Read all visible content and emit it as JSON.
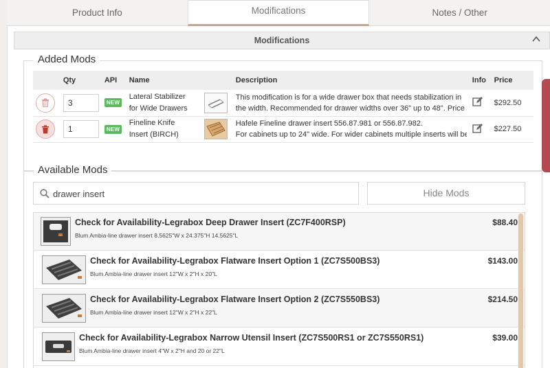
{
  "tabs": [
    {
      "label": "Product Info"
    },
    {
      "label": "Modifications"
    },
    {
      "label": "Notes / Other"
    }
  ],
  "section": {
    "title": "Modifications"
  },
  "added_mods": {
    "legend": "Added Mods",
    "columns": {
      "qty": "Qty",
      "api": "API",
      "name": "Name",
      "description": "Description",
      "info": "Info",
      "price": "Price"
    },
    "rows": [
      {
        "qty": "3",
        "api_badge": "NEW",
        "name_line1": "Lateral Stabilizer",
        "name_line2": "for Wide Drawers",
        "desc_line1": "This modification is for a wide drawer box that needs stabilization in",
        "desc_line2": "the width. Recommended for drawer widths over 36\" up to 48\". Price",
        "price": "$292.50"
      },
      {
        "qty": "1",
        "api_badge": "NEW",
        "name_line1": "Fineline Knife",
        "name_line2": "Insert (BIRCH)",
        "desc_line1": "Hafele Fineline drawer insert 556.87.981 or 556.87.982.",
        "desc_line2": "For cabinets up to 24\" wide. For wider cabinets multiple inserts will be",
        "price": "$227.50"
      }
    ]
  },
  "available_mods": {
    "legend": "Available Mods",
    "search_value": "drawer insert",
    "hide_button": "Hide Mods",
    "items": [
      {
        "title": "Check for Availability-Legrabox Deep Drawer Insert (ZC7F400RSP)",
        "subtitle": "Blum Ambia-line drawer insert 8.5625\"W x 24.375\"H 14.5625\"L",
        "price": "$88.40"
      },
      {
        "title": "Check for Availability-Legrabox Flatware Insert Option 1 (ZC7S500BS3)",
        "subtitle": "Blum Ambia-line drawer insert 12\"W x 2\"H x 20\"L",
        "price": "$143.00"
      },
      {
        "title": "Check for Availability-Legrabox Flatware Insert Option 2 (ZC7S550BS3)",
        "subtitle": "Blum Ambia-line drawer insert 12\"W x 2\"H x 22\"L",
        "price": "$214.50"
      },
      {
        "title": "Check for Availability-Legrabox Narrow Utensil Insert (ZC7S500RS1 or ZC7S550RS1)",
        "subtitle": "Blum Ambia-line drawer insert 4\"W x 2\"H and 20 or 22\"L",
        "price": "$39.00"
      }
    ]
  },
  "colors": {
    "accent": "#c8a486",
    "badge": "#5cb85c",
    "delete": "#c0392b",
    "side_tab": "#b34a4f"
  }
}
